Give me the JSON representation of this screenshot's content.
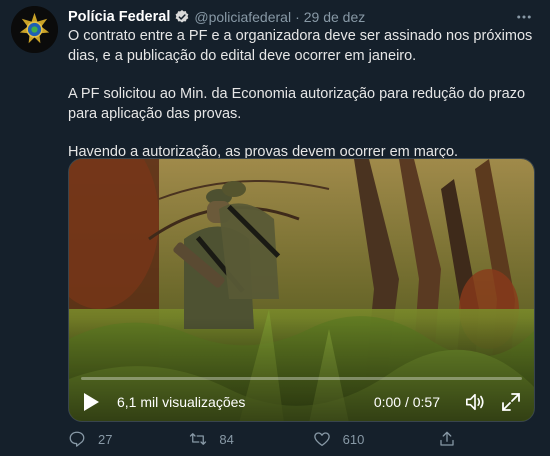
{
  "author": {
    "name": "Polícia Federal",
    "handle": "@policiafederal",
    "separator": "·",
    "date": "29 de dez"
  },
  "tweet": {
    "paragraphs": [
      "O contrato entre a PF e a organizadora deve ser assinado nos próximos dias, e a publicação do edital deve ocorrer em janeiro.",
      "A PF solicitou ao Min. da Economia autorização para redução do prazo para aplicação das provas.",
      "Havendo a autorização, as provas devem ocorrer em março."
    ]
  },
  "video": {
    "views": "6,1 mil visualizações",
    "time": "0:00 / 0:57",
    "progress": 0
  },
  "actions": {
    "replies": "27",
    "retweets": "84",
    "likes": "610"
  },
  "icons": {
    "verified": "verified-badge-icon",
    "more": "more-icon",
    "play": "play-icon",
    "volume": "volume-icon",
    "fullscreen": "fullscreen-icon",
    "reply": "reply-icon",
    "retweet": "retweet-icon",
    "like": "heart-icon",
    "share": "share-icon"
  },
  "colors": {
    "background": "#15202b",
    "secondary_text": "#8899a6",
    "verified": "#1da1f2"
  }
}
